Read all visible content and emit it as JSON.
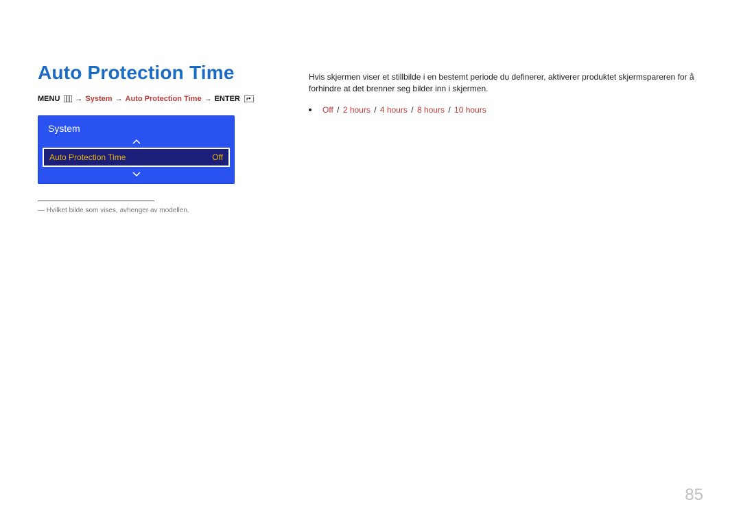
{
  "title": "Auto Protection Time",
  "breadcrumb": {
    "menu": "MENU",
    "arrow": "→",
    "system": "System",
    "item": "Auto Protection Time",
    "enter": "ENTER"
  },
  "osd": {
    "header": "System",
    "row_label": "Auto Protection Time",
    "row_value": "Off"
  },
  "footnote_prefix": "―",
  "footnote": "Hvilket bilde som vises, avhenger av modellen.",
  "description": "Hvis skjermen viser et stillbilde i en bestemt periode du definerer, aktiverer produktet skjermspareren for å forhindre at det brenner seg bilder inn i skjermen.",
  "options": [
    "Off",
    "2 hours",
    "4 hours",
    "8 hours",
    "10 hours"
  ],
  "option_separator": "/",
  "page_number": "85"
}
